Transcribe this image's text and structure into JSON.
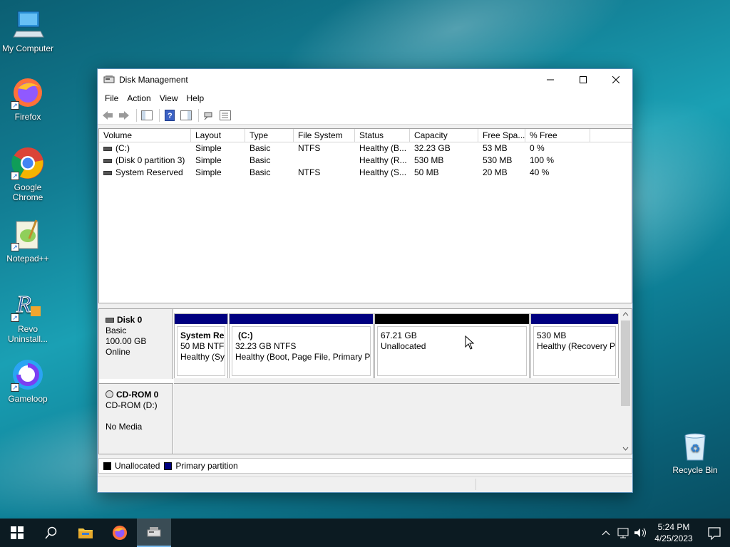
{
  "desktop": {
    "icons": [
      {
        "label": "My Computer",
        "icon": "computer-icon"
      },
      {
        "label": "Firefox",
        "icon": "firefox-icon"
      },
      {
        "label": "Google Chrome",
        "icon": "chrome-icon"
      },
      {
        "label": "Notepad++",
        "icon": "notepadpp-icon"
      },
      {
        "label": "Revo Uninstall...",
        "icon": "revo-icon"
      },
      {
        "label": "Gameloop",
        "icon": "gameloop-icon"
      },
      {
        "label": "Recycle Bin",
        "icon": "recycle-bin-icon"
      }
    ]
  },
  "window": {
    "title": "Disk Management",
    "menu": [
      "File",
      "Action",
      "View",
      "Help"
    ],
    "toolbar_icons": [
      "back-icon",
      "forward-icon",
      "show-hide-console-tree-icon",
      "help-icon",
      "show-hide-action-pane-icon",
      "connect-disk-icon",
      "properties-icon"
    ]
  },
  "volumes": {
    "columns": [
      "Volume",
      "Layout",
      "Type",
      "File System",
      "Status",
      "Capacity",
      "Free Spa...",
      "% Free"
    ],
    "rows": [
      [
        "(C:)",
        "Simple",
        "Basic",
        "NTFS",
        "Healthy (B...",
        "32.23 GB",
        "53 MB",
        "0 %"
      ],
      [
        "(Disk 0 partition 3)",
        "Simple",
        "Basic",
        "",
        "Healthy (R...",
        "530 MB",
        "530 MB",
        "100 %"
      ],
      [
        "System Reserved",
        "Simple",
        "Basic",
        "NTFS",
        "Healthy (S...",
        "50 MB",
        "20 MB",
        "40 %"
      ]
    ]
  },
  "disks": [
    {
      "name": "Disk 0",
      "type": "Basic",
      "size": "100.00 GB",
      "state": "Online",
      "partitions": [
        {
          "title": "System Res",
          "line1": "50 MB NTFS",
          "line2": "Healthy (Sy",
          "kind": "primary"
        },
        {
          "title": "(C:)",
          "line1": "32.23 GB NTFS",
          "line2": "Healthy (Boot, Page File, Primary Pa",
          "kind": "primary"
        },
        {
          "title": "",
          "line1": "67.21 GB",
          "line2": "Unallocated",
          "kind": "unallocated"
        },
        {
          "title": "",
          "line1": "530 MB",
          "line2": "Healthy (Recovery Pa",
          "kind": "primary"
        }
      ]
    },
    {
      "name": "CD-ROM 0",
      "type": "CD-ROM (D:)",
      "size": "",
      "state": "No Media"
    }
  ],
  "legend": [
    {
      "label": "Unallocated",
      "color": "#000000"
    },
    {
      "label": "Primary partition",
      "color": "#000080"
    }
  ],
  "colors": {
    "primary": "#000080",
    "unallocated": "#000000"
  },
  "taskbar": {
    "time": "5:24 PM",
    "date": "4/25/2023"
  }
}
